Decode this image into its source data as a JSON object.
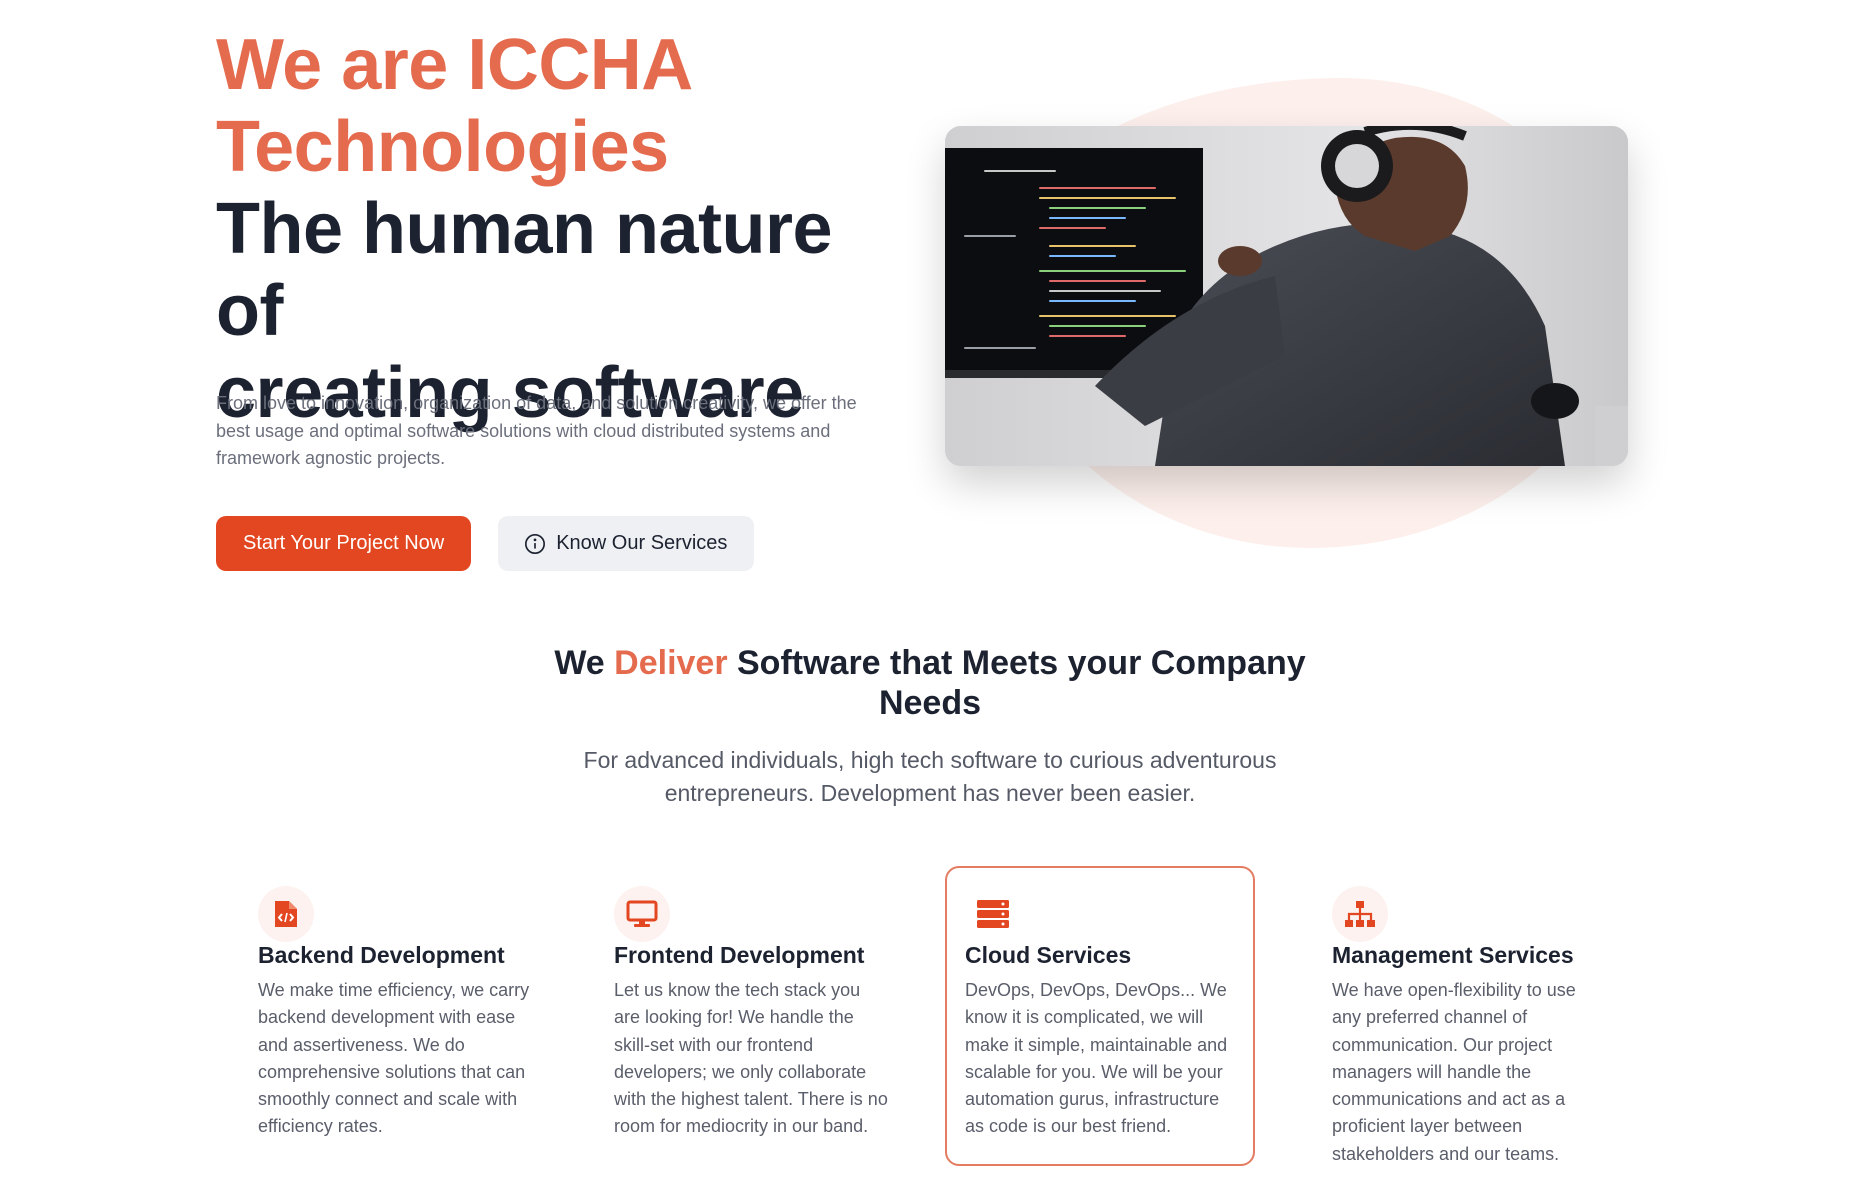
{
  "hero": {
    "title_line1": "We are ICCHA",
    "title_line2": "Technologies",
    "subtitle_line1": "The human nature of",
    "subtitle_line2": "creating software",
    "description": "From love to innovation, organization of data, and solution creativity, we offer the best usage and optimal software solutions with cloud distributed systems and framework agnostic projects.",
    "primary_button": "Start Your Project Now",
    "secondary_button": "Know Our Services"
  },
  "section": {
    "title_before": "We ",
    "title_accent": "Deliver",
    "title_after": " Software that Meets your Company Needs",
    "subtitle": "For advanced individuals, high tech software to curious adventurous entrepreneurs. Development has never been easier."
  },
  "services": [
    {
      "icon": "file-code-icon",
      "title": "Backend Development",
      "description": "We make time efficiency, we carry backend development with ease and assertiveness. We do comprehensive solutions that can smoothly connect and scale with efficiency rates."
    },
    {
      "icon": "monitor-icon",
      "title": "Frontend Development",
      "description": "Let us know the tech stack you are looking for! We handle the skill-set with our frontend developers; we only collaborate with the highest talent. There is no room for mediocrity in our band."
    },
    {
      "icon": "server-icon",
      "title": "Cloud Services",
      "description": "DevOps, DevOps, DevOps... We know it is complicated, we will make it simple, maintainable and scalable for you. We will be your automation gurus, infrastructure as code is our best friend."
    },
    {
      "icon": "sitemap-icon",
      "title": "Management Services",
      "description": "We have open-flexibility to use any preferred channel of communication. Our project managers will handle the communications and act as a proficient layer between stakeholders and our teams."
    }
  ],
  "colors": {
    "accent": "#e56b4e",
    "primary_button": "#e34721",
    "heading": "#1c2230",
    "highlight_border": "#e47c62"
  }
}
